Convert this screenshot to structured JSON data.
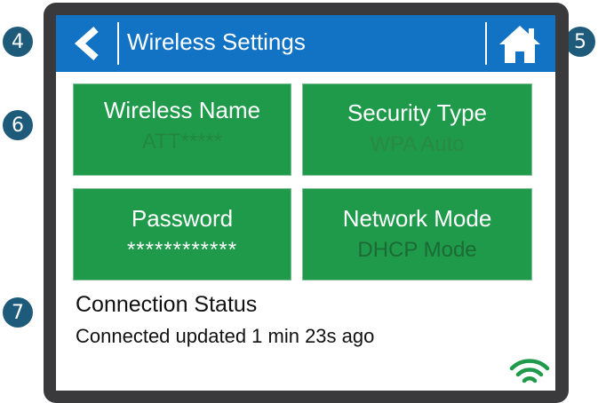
{
  "callouts": [
    "4",
    "5",
    "6",
    "7"
  ],
  "header": {
    "title": "Wireless Settings",
    "back_icon": "chevron-left-icon",
    "home_icon": "home-icon"
  },
  "tiles": [
    {
      "label": "Wireless Name",
      "value": "ATT*****",
      "value_color": "#23873f"
    },
    {
      "label": "Security Type",
      "value": "WPA Auto",
      "value_color": "#2a8a43"
    },
    {
      "label": "Password",
      "value": "************",
      "value_color": "#ffffff"
    },
    {
      "label": "Network Mode",
      "value": "DHCP Mode",
      "value_color": "#1c6a34"
    }
  ],
  "status": {
    "title": "Connection Status",
    "text": "Connected updated 1 min 23s ago",
    "icon": "wifi-icon"
  },
  "colors": {
    "header_blue": "#1273c4",
    "tile_green": "#1f9a4b",
    "bezel": "#3a3a3c",
    "callout": "#1e5a7a",
    "wifi": "#1f9a4b"
  }
}
